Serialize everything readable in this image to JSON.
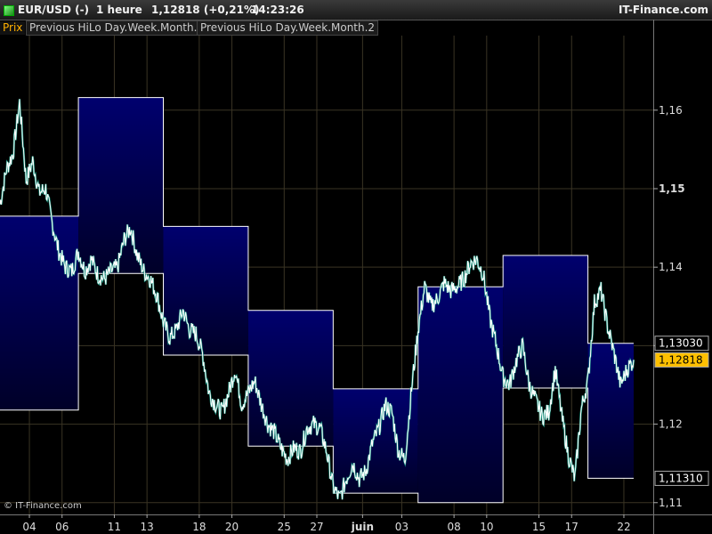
{
  "header": {
    "symbol": "EUR/USD (-)",
    "timeframe": "1 heure",
    "quote": "1,12818 (+0,21%)",
    "time": "14:23:26",
    "brand": "IT-Finance.com"
  },
  "legend": {
    "price": "Prix",
    "indicator1": "Previous HiLo Day.Week.Month.",
    "indicator2": "Previous HiLo Day.Week.Month.2"
  },
  "copyright": "© IT-Finance.com",
  "colors": {
    "background": "#000000",
    "fill_top": "#00006e",
    "fill_bottom": "#000028",
    "band_line": "#ffffff",
    "price_line": "#ffffff",
    "price_accent": "#1aa38c",
    "grid": "#3a3424",
    "current_label": "#ffc000"
  },
  "chart_data": {
    "type": "line",
    "title": "EUR/USD (-) 1 heure",
    "ylim": [
      1.1085,
      1.1695
    ],
    "y_ticks": [
      {
        "value": 1.11,
        "label": "1,11",
        "bold": false
      },
      {
        "value": 1.12,
        "label": "1,12",
        "bold": false
      },
      {
        "value": 1.13,
        "label": "1,13",
        "bold": false
      },
      {
        "value": 1.14,
        "label": "1,14",
        "bold": false
      },
      {
        "value": 1.15,
        "label": "1,15",
        "bold": true
      },
      {
        "value": 1.16,
        "label": "1,16",
        "bold": false
      }
    ],
    "x_ticks": [
      {
        "x": 0.045,
        "label": "04"
      },
      {
        "x": 0.095,
        "label": "06"
      },
      {
        "x": 0.175,
        "label": "11"
      },
      {
        "x": 0.225,
        "label": "13"
      },
      {
        "x": 0.305,
        "label": "18"
      },
      {
        "x": 0.355,
        "label": "20"
      },
      {
        "x": 0.435,
        "label": "25"
      },
      {
        "x": 0.485,
        "label": "27"
      },
      {
        "x": 0.555,
        "label": "juin",
        "bold": true
      },
      {
        "x": 0.615,
        "label": "03"
      },
      {
        "x": 0.695,
        "label": "08"
      },
      {
        "x": 0.745,
        "label": "10"
      },
      {
        "x": 0.825,
        "label": "15"
      },
      {
        "x": 0.875,
        "label": "17"
      },
      {
        "x": 0.955,
        "label": "22"
      }
    ],
    "bands": [
      {
        "x0": 0.0,
        "x1": 0.12,
        "high": 1.1465,
        "low": 1.1218
      },
      {
        "x0": 0.12,
        "x1": 0.25,
        "high": 1.1616,
        "low": 1.1392
      },
      {
        "x0": 0.25,
        "x1": 0.38,
        "high": 1.1452,
        "low": 1.1288
      },
      {
        "x0": 0.38,
        "x1": 0.51,
        "high": 1.1345,
        "low": 1.1172
      },
      {
        "x0": 0.51,
        "x1": 0.64,
        "high": 1.1245,
        "low": 1.1112
      },
      {
        "x0": 0.64,
        "x1": 0.77,
        "high": 1.1375,
        "low": 1.11
      },
      {
        "x0": 0.77,
        "x1": 0.9,
        "high": 1.1415,
        "low": 1.1246
      },
      {
        "x0": 0.9,
        "x1": 0.97,
        "high": 1.1303,
        "low": 1.1131
      }
    ],
    "series": [
      {
        "x": [
          0.0,
          0.01,
          0.02,
          0.03,
          0.04,
          0.05,
          0.06,
          0.07,
          0.08,
          0.09,
          0.1,
          0.11,
          0.12,
          0.13,
          0.14,
          0.15,
          0.16,
          0.17,
          0.18,
          0.19,
          0.2,
          0.21,
          0.22,
          0.23,
          0.24,
          0.25,
          0.26,
          0.27,
          0.28,
          0.29,
          0.3,
          0.31,
          0.32,
          0.33,
          0.34,
          0.35,
          0.36,
          0.37,
          0.38,
          0.39,
          0.4,
          0.41,
          0.42,
          0.43,
          0.44,
          0.45,
          0.46,
          0.47,
          0.48,
          0.49,
          0.5,
          0.51,
          0.52,
          0.53,
          0.54,
          0.55,
          0.56,
          0.57,
          0.58,
          0.59,
          0.6,
          0.61,
          0.62,
          0.63,
          0.64,
          0.65,
          0.66,
          0.67,
          0.68,
          0.69,
          0.7,
          0.71,
          0.72,
          0.73,
          0.74,
          0.75,
          0.76,
          0.77,
          0.78,
          0.79,
          0.8,
          0.81,
          0.82,
          0.83,
          0.84,
          0.85,
          0.86,
          0.87,
          0.88,
          0.89,
          0.9,
          0.91,
          0.92,
          0.93,
          0.94,
          0.95,
          0.96,
          0.97
        ],
        "y": [
          1.148,
          1.1525,
          1.1545,
          1.161,
          1.151,
          1.1535,
          1.1495,
          1.15,
          1.1455,
          1.142,
          1.14,
          1.1395,
          1.142,
          1.1395,
          1.141,
          1.139,
          1.1385,
          1.1395,
          1.14,
          1.1435,
          1.145,
          1.1415,
          1.1395,
          1.1385,
          1.1365,
          1.133,
          1.131,
          1.132,
          1.1345,
          1.132,
          1.1315,
          1.129,
          1.124,
          1.1225,
          1.1215,
          1.124,
          1.127,
          1.1225,
          1.124,
          1.1255,
          1.1225,
          1.12,
          1.119,
          1.117,
          1.1155,
          1.117,
          1.1165,
          1.1195,
          1.12,
          1.1195,
          1.1165,
          1.112,
          1.1105,
          1.113,
          1.115,
          1.113,
          1.114,
          1.1175,
          1.1195,
          1.1225,
          1.1215,
          1.1165,
          1.1155,
          1.1245,
          1.132,
          1.1375,
          1.135,
          1.136,
          1.138,
          1.137,
          1.1375,
          1.1385,
          1.1405,
          1.141,
          1.139,
          1.1335,
          1.13,
          1.126,
          1.125,
          1.128,
          1.13,
          1.125,
          1.123,
          1.121,
          1.1215,
          1.127,
          1.121,
          1.116,
          1.113,
          1.122,
          1.1255,
          1.1355,
          1.137,
          1.1325,
          1.129,
          1.125,
          1.127,
          1.1282
        ]
      }
    ],
    "current_price_label": "1,12818",
    "current_price_value": 1.12818,
    "band_high_label": "1,13030",
    "band_high_value": 1.1303,
    "band_low_label": "1,11310",
    "band_low_value": 1.1131
  }
}
